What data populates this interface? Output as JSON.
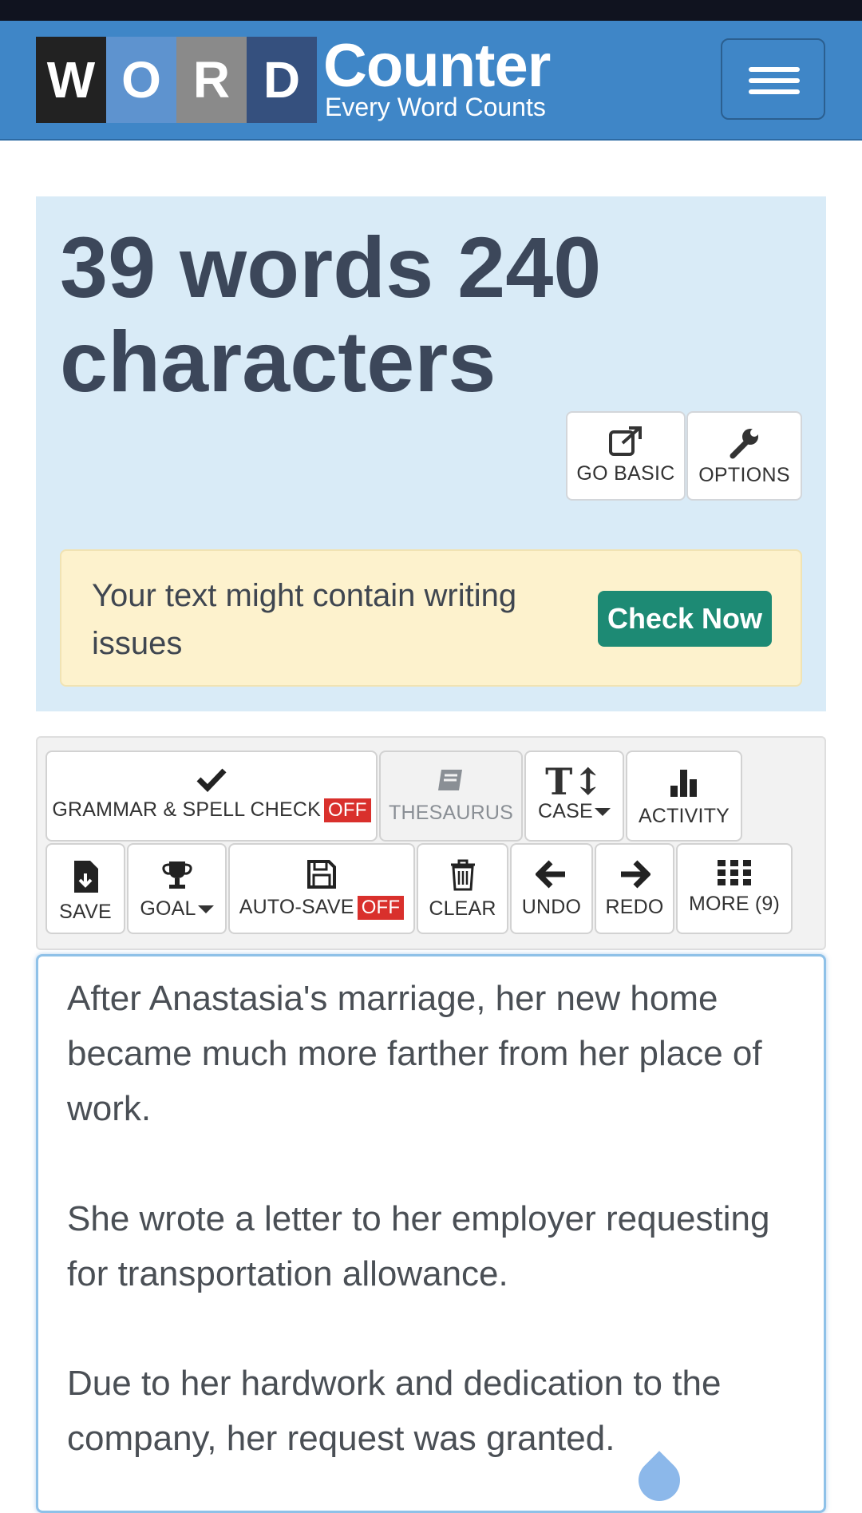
{
  "header": {
    "logo_letters": [
      "W",
      "O",
      "R",
      "D"
    ],
    "logo_tile_colors": [
      "#222222",
      "#5e93cf",
      "#8a8a8a",
      "#35507e"
    ],
    "logo_name": "Counter",
    "logo_tagline": "Every Word Counts",
    "menu_icon": "hamburger-menu-icon"
  },
  "stats": {
    "headline": "39 words 240 characters",
    "go_basic_label": "GO BASIC",
    "options_label": "OPTIONS"
  },
  "notice": {
    "text": "Your text might contain writing issues",
    "button_label": "Check Now"
  },
  "toolbar": {
    "grammar_label": "GRAMMAR & SPELL CHECK",
    "grammar_state": "OFF",
    "thesaurus_label": "THESAURUS",
    "case_label": "CASE",
    "activity_label": "ACTIVITY",
    "save_label": "SAVE",
    "goal_label": "GOAL",
    "autosave_label": "AUTO-SAVE",
    "autosave_state": "OFF",
    "clear_label": "CLEAR",
    "undo_label": "UNDO",
    "redo_label": "REDO",
    "more_label": "MORE (9)"
  },
  "editor": {
    "paragraphs": [
      "After Anastasia's marriage, her new home became much more farther from her place of work.",
      "She wrote a letter to her employer requesting for transportation allowance.",
      "Due to her hardwork and dedication to the company, her request was granted."
    ]
  },
  "colors": {
    "header_bg": "#3f86c7",
    "stats_bg": "#d9ebf7",
    "notice_bg": "#fdf2cd",
    "check_now_bg": "#1d8a74",
    "off_badge": "#d9302c"
  }
}
